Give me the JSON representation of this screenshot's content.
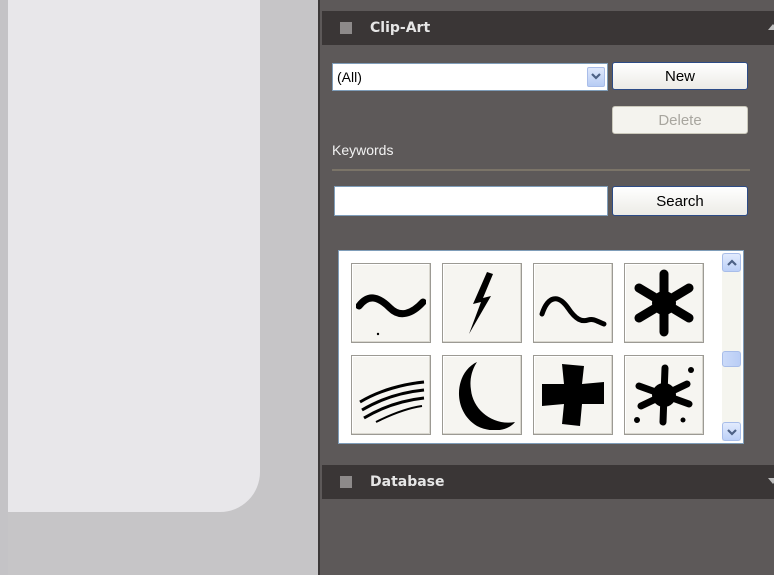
{
  "clip_art_panel": {
    "title": "Clip-Art",
    "category_select": {
      "value": "(All)"
    },
    "new_label": "New",
    "delete_label": "Delete",
    "keywords_label": "Keywords",
    "search_input": {
      "value": "",
      "placeholder": ""
    },
    "search_label": "Search",
    "clips": [
      "wave-stroke",
      "lightning-bolt",
      "squiggle-line",
      "asterisk-star",
      "speed-lines",
      "crescent-moon",
      "cross-shape",
      "ink-splat"
    ]
  },
  "database_panel": {
    "title": "Database"
  },
  "colors": {
    "panel_bg": "#5d5959",
    "header_bg": "#3a3636",
    "canvas_bg": "#e8e7ea"
  }
}
